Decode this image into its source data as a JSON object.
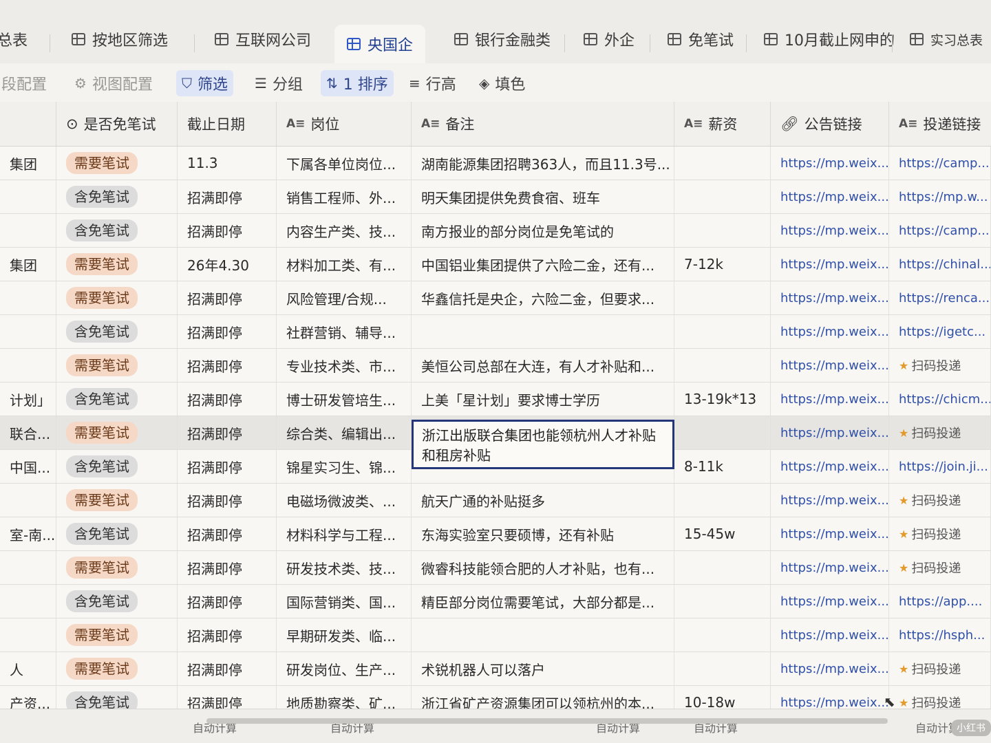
{
  "tabs": [
    {
      "label": "总表"
    },
    {
      "label": "按地区筛选"
    },
    {
      "label": "互联网公司"
    },
    {
      "label": "央国企"
    },
    {
      "label": "银行金融类"
    },
    {
      "label": "外企"
    },
    {
      "label": "免笔试"
    },
    {
      "label": "10月截止网申的"
    },
    {
      "label": "实习总表"
    }
  ],
  "toolbar": {
    "field_config": "段配置",
    "view_config": "视图配置",
    "filter": "筛选",
    "group": "分组",
    "sort": "1 排序",
    "row_height": "行高",
    "fill": "填色"
  },
  "columns": {
    "exam": "是否免笔试",
    "deadline": "截止日期",
    "position": "岗位",
    "note": "备注",
    "salary": "薪资",
    "notice": "公告链接",
    "apply": "投递链接",
    "type_prefix": "A≡"
  },
  "rows": [
    {
      "company": "集团",
      "exam": "需要笔试",
      "exam_type": "need",
      "deadline": "11.3",
      "position": "下属各单位岗位...",
      "note": "湖南能源集团招聘363人，而且11.3号...",
      "salary": "",
      "notice": "https://mp.weix...",
      "apply": "https://camp..."
    },
    {
      "company": "",
      "exam": "含免笔试",
      "exam_type": "free",
      "deadline": "招满即停",
      "position": "销售工程师、外...",
      "note": "明天集团提供免费食宿、班车",
      "salary": "",
      "notice": "https://mp.weix...",
      "apply": "https://mp.w..."
    },
    {
      "company": "",
      "exam": "含免笔试",
      "exam_type": "free",
      "deadline": "招满即停",
      "position": "内容生产类、技...",
      "note": "南方报业的部分岗位是免笔试的",
      "salary": "",
      "notice": "https://mp.weix...",
      "apply": "https://camp..."
    },
    {
      "company": "集团",
      "exam": "需要笔试",
      "exam_type": "need",
      "deadline": "26年4.30",
      "position": "材料加工类、有...",
      "note": "中国铝业集团提供了六险二金，还有...",
      "salary": "7-12k",
      "notice": "https://mp.weix...",
      "apply": "https://chinal..."
    },
    {
      "company": "",
      "exam": "需要笔试",
      "exam_type": "need",
      "deadline": "招满即停",
      "position": "风险管理/合规...",
      "note": "华鑫信托是央企，六险二金，但要求...",
      "salary": "",
      "notice": "https://mp.weix...",
      "apply": "https://renca..."
    },
    {
      "company": "",
      "exam": "含免笔试",
      "exam_type": "free",
      "deadline": "招满即停",
      "position": "社群营销、辅导...",
      "note": "",
      "salary": "",
      "notice": "https://mp.weix...",
      "apply": "https://igetc..."
    },
    {
      "company": "",
      "exam": "需要笔试",
      "exam_type": "need",
      "deadline": "招满即停",
      "position": "专业技术类、市...",
      "note": "美恒公司总部在大连，有人才补贴和...",
      "salary": "",
      "notice": "https://mp.weix...",
      "apply": "扫码投递"
    },
    {
      "company": "计划」",
      "exam": "含免笔试",
      "exam_type": "free",
      "deadline": "招满即停",
      "position": "博士研发管培生...",
      "note": "上美「星计划」要求博士学历",
      "salary": "13-19k*13",
      "notice": "https://mp.weix...",
      "apply": "https://chicm..."
    },
    {
      "company": "联合...",
      "exam": "需要笔试",
      "exam_type": "need",
      "deadline": "招满即停",
      "position": "综合类、编辑出...",
      "note": "浙江出版联合集团也能领杭州人才补贴和租房补贴",
      "salary": "",
      "notice": "https://mp.weix...",
      "apply": "扫码投递"
    },
    {
      "company": "中国...",
      "exam": "含免笔试",
      "exam_type": "free",
      "deadline": "招满即停",
      "position": "锦星实习生、锦...",
      "note": "",
      "salary": "8-11k",
      "notice": "https://mp.weix...",
      "apply": "https://join.ji..."
    },
    {
      "company": "",
      "exam": "需要笔试",
      "exam_type": "need",
      "deadline": "招满即停",
      "position": "电磁场微波类、...",
      "note": "航天广通的补贴挺多",
      "salary": "",
      "notice": "https://mp.weix...",
      "apply": "扫码投递"
    },
    {
      "company": "室-南...",
      "exam": "含免笔试",
      "exam_type": "free",
      "deadline": "招满即停",
      "position": "材料科学与工程...",
      "note": "东海实验室只要硕博，还有补贴",
      "salary": "15-45w",
      "notice": "https://mp.weix...",
      "apply": "扫码投递"
    },
    {
      "company": "",
      "exam": "需要笔试",
      "exam_type": "need",
      "deadline": "招满即停",
      "position": "研发技术类、技...",
      "note": "微睿科技能领合肥的人才补贴，也有...",
      "salary": "",
      "notice": "https://mp.weix...",
      "apply": "扫码投递"
    },
    {
      "company": "",
      "exam": "含免笔试",
      "exam_type": "free",
      "deadline": "招满即停",
      "position": "国际营销类、国...",
      "note": "精臣部分岗位需要笔试，大部分都是...",
      "salary": "",
      "notice": "https://mp.weix...",
      "apply": "https://app...."
    },
    {
      "company": "",
      "exam": "需要笔试",
      "exam_type": "need",
      "deadline": "招满即停",
      "position": "早期研发类、临...",
      "note": "",
      "salary": "",
      "notice": "https://mp.weix...",
      "apply": "https://hsph..."
    },
    {
      "company": "人",
      "exam": "需要笔试",
      "exam_type": "need",
      "deadline": "招满即停",
      "position": "研发岗位、生产...",
      "note": "术锐机器人可以落户",
      "salary": "",
      "notice": "https://mp.weix...",
      "apply": "扫码投递"
    },
    {
      "company": "产资...",
      "exam": "含免笔试",
      "exam_type": "free",
      "deadline": "招满即停",
      "position": "地质勘察类、矿...",
      "note": "浙江省矿产资源集团可以领杭州的本...",
      "salary": "10-18w",
      "notice": "https://mp.weix...",
      "apply": "扫码投递"
    }
  ],
  "footer": {
    "auto": "自动计算"
  },
  "watermark": "小红书"
}
